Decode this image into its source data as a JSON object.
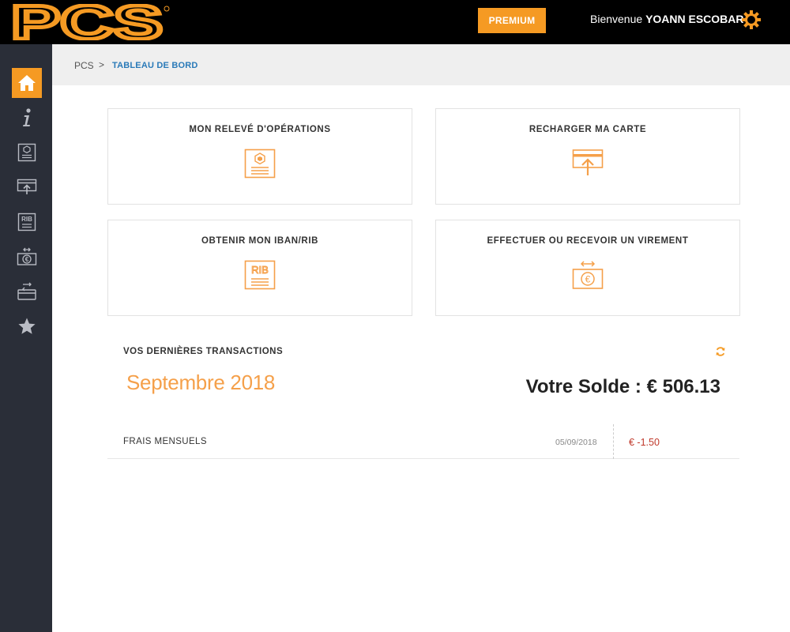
{
  "header": {
    "logo_text": "PCS",
    "premium_label": "PREMIUM",
    "welcome_prefix": "Bienvenue",
    "user_name": "YOANN ESCOBAR"
  },
  "sidebar": {
    "items": [
      {
        "icon": "home-icon",
        "active": true
      },
      {
        "icon": "info-icon"
      },
      {
        "icon": "statement-icon"
      },
      {
        "icon": "recharge-card-icon"
      },
      {
        "icon": "rib-icon"
      },
      {
        "icon": "transfer-icon"
      },
      {
        "icon": "card-transfer-icon"
      },
      {
        "icon": "star-icon"
      }
    ]
  },
  "breadcrumb": {
    "root": "PCS",
    "separator": ">",
    "current": "TABLEAU DE BORD"
  },
  "cards": [
    {
      "title": "MON RELEVÉ D'OPÉRATIONS",
      "icon": "statement-icon"
    },
    {
      "title": "RECHARGER MA CARTE",
      "icon": "recharge-card-icon"
    },
    {
      "title": "OBTENIR MON IBAN/RIB",
      "icon": "rib-icon",
      "icon_text": "RIB"
    },
    {
      "title": "EFFECTUER OU RECEVOIR UN VIREMENT",
      "icon": "transfer-icon"
    }
  ],
  "transactions": {
    "title": "VOS DERNIÈRES TRANSACTIONS",
    "month": "Septembre 2018",
    "balance_label": "Votre Solde : € 506.13",
    "rows": [
      {
        "label": "FRAIS MENSUELS",
        "date": "05/09/2018",
        "amount": "€ -1.50"
      }
    ]
  },
  "colors": {
    "accent": "#f59a23",
    "sidebar_bg": "#2a2e38",
    "topbar_bg": "#000000",
    "breadcrumb_link": "#2a7ab8",
    "negative": "#c0392b"
  }
}
